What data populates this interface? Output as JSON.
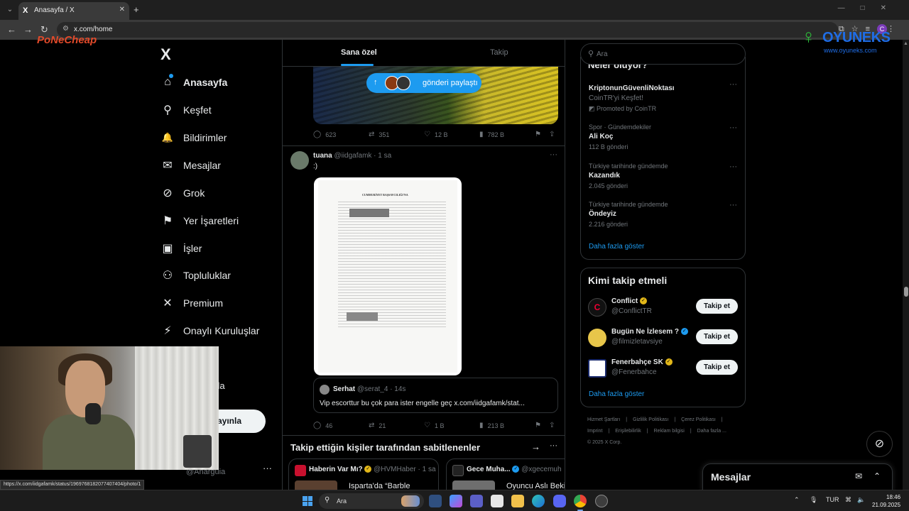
{
  "browser": {
    "tab_title": "Anasayfa / X",
    "tab_favicon": "X",
    "url": "x.com/home",
    "profile_initial": "C",
    "status_url": "https://x.com/iidgafamk/status/1969768182077407404/photo/1"
  },
  "watermarks": {
    "left": "PoNeCheap",
    "right_title": "OYUNEKS",
    "right_sub": "www.oyuneks.com"
  },
  "sidebar": {
    "logo": "X",
    "items": [
      {
        "label": "Anasayfa",
        "icon": "home-icon",
        "glyph": "⌂"
      },
      {
        "label": "Keşfet",
        "icon": "search-icon",
        "glyph": "⚲"
      },
      {
        "label": "Bildirimler",
        "icon": "bell-icon",
        "glyph": "🔔"
      },
      {
        "label": "Mesajlar",
        "icon": "mail-icon",
        "glyph": "✉"
      },
      {
        "label": "Grok",
        "icon": "grok-icon",
        "glyph": "⊘"
      },
      {
        "label": "Yer İşaretleri",
        "icon": "bookmark-icon",
        "glyph": "⚑"
      },
      {
        "label": "İşler",
        "icon": "briefcase-icon",
        "glyph": "▣"
      },
      {
        "label": "Topluluklar",
        "icon": "communities-icon",
        "glyph": "⚇"
      },
      {
        "label": "Premium",
        "icon": "x-premium-icon",
        "glyph": "✕"
      },
      {
        "label": "Onaylı Kuruluşlar",
        "icon": "lightning-icon",
        "glyph": "⚡"
      }
    ],
    "partial_label": "zla",
    "post_button": "ayınla",
    "account_handle": "@Anarguia",
    "more": "···"
  },
  "feed": {
    "tabs": [
      {
        "label": "Sana özel"
      },
      {
        "label": "Takip"
      }
    ],
    "share_pill": "gönderi paylaştı",
    "post1_stats": {
      "replies": "623",
      "reposts": "351",
      "likes": "12 B",
      "views": "782 B"
    },
    "tweet": {
      "name": "tuana",
      "handle": "@iidgafamk · 1 sa",
      "text": ":)",
      "doc_title": "CUMHURİYET BAŞSAVCILIĞI'NA",
      "quote": {
        "name": "Serhat",
        "handle": "@serat_4 · 14s",
        "text": "Vip escorttur bu çok para ister engelle geç x.com/iidgafamk/stat..."
      },
      "stats": {
        "replies": "46",
        "reposts": "21",
        "likes": "1 B",
        "views": "213 B"
      }
    },
    "pinned": {
      "title": "Takip ettiğin kişiler tarafından sabitlenenler",
      "cards": [
        {
          "name": "Haberin Var Mı?",
          "handle": "@HVMHaber · 1 sa",
          "text": "Isparta'da “Barble"
        },
        {
          "name": "Gece Muha...",
          "handle": "@xgecemuh",
          "text": "Oyuncu Aslı Bekiro"
        }
      ]
    }
  },
  "right": {
    "search_placeholder": "Ara",
    "trends_title": "Neler oluyor?",
    "trends": [
      {
        "category": "",
        "title": "KriptonunGüvenliNoktası",
        "sub": "CoinTR'yi Keşfet!",
        "sub2": "Promoted by CoinTR"
      },
      {
        "category": "Spor · Gündemdekiler",
        "title": "Ali Koç",
        "sub": "112 B gönderi",
        "sub2": ""
      },
      {
        "category": "Türkiye tarihinde gündemde",
        "title": "Kazandık",
        "sub": "2.045 gönderi",
        "sub2": ""
      },
      {
        "category": "Türkiye tarihinde gündemde",
        "title": "Öndeyiz",
        "sub": "2.216 gönderi",
        "sub2": ""
      }
    ],
    "show_more": "Daha fazla göster",
    "who_title": "Kimi takip etmeli",
    "who": [
      {
        "name": "Conflict",
        "handle": "@ConflictTR",
        "badge": "gold"
      },
      {
        "name": "Bugün Ne İzlesem ?",
        "handle": "@filmizletavsiye",
        "badge": "blue"
      },
      {
        "name": "Fenerbahçe SK",
        "handle": "@Fenerbahce",
        "badge": "gold"
      }
    ],
    "follow_label": "Takip et",
    "footer": [
      "Hizmet Şartları",
      "Gizlilik Politikası",
      "Çerez Politikası",
      "Imprint",
      "Erişilebilirlik",
      "Reklam bilgisi",
      "Daha fazla ...",
      "© 2025 X Corp."
    ],
    "messages_dock": "Mesajlar"
  },
  "taskbar": {
    "search": "Ara",
    "lang": "TUR",
    "time": "18:46",
    "date": "21.09.2025"
  },
  "colors": {
    "accent": "#1d9bf0",
    "background": "#000000",
    "border": "#2f3336",
    "muted": "#71767b",
    "gold_badge": "#e2b719"
  }
}
